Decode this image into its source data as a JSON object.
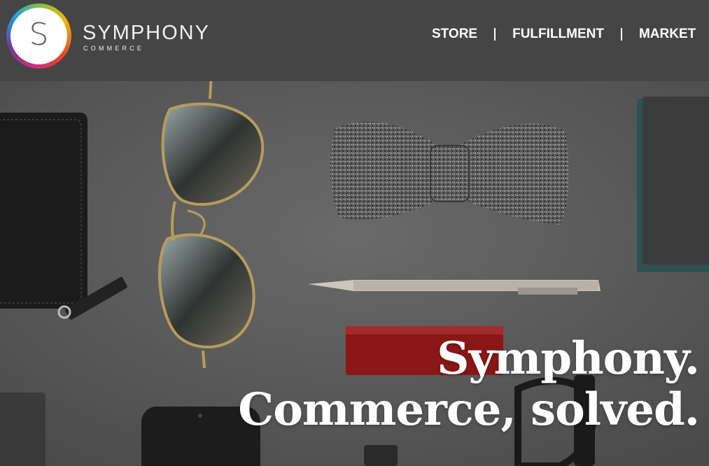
{
  "brand": {
    "name": "SYMPHONY",
    "sub": "COMMERCE",
    "logo_letter": "S"
  },
  "nav": {
    "items": [
      "STORE",
      "FULFILLMENT",
      "MARKET"
    ]
  },
  "hero": {
    "line1": "Symphony.",
    "line2": "Commerce, solved."
  },
  "colors": {
    "header": "#454545",
    "background": "#585858"
  }
}
